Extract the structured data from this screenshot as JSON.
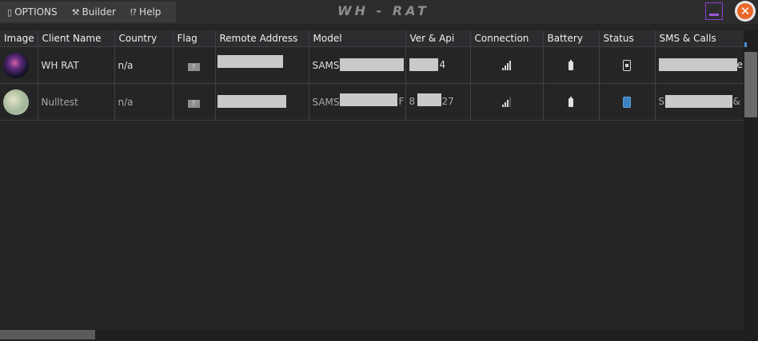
{
  "menu": {
    "items": [
      {
        "icon": "document-icon",
        "glyph": "▯",
        "label": "OPTIONS"
      },
      {
        "icon": "tools-icon",
        "glyph": "⚒",
        "label": "Builder"
      },
      {
        "icon": "help-icon",
        "glyph": "⁉",
        "label": "Help"
      }
    ]
  },
  "app": {
    "title": "WH - RAT"
  },
  "window_controls": {
    "close_glyph": "✕"
  },
  "columns": [
    "Image",
    "Client Name",
    "Country",
    "Flag",
    "Remote Address",
    "Model",
    "Ver & Api",
    "Connection",
    "Battery",
    "Status",
    "SMS & Calls"
  ],
  "rows": [
    {
      "avatar": "avatar-galaxy",
      "client_name": "WH RAT",
      "country": "n/a",
      "flag": "?",
      "model_prefix": "SAMSU",
      "ver_suffix": "4",
      "sms_suffix": "e",
      "signal_bars": 4,
      "status": "phone-locked-icon"
    },
    {
      "avatar": "avatar-floral",
      "client_name": "Nulltest",
      "country": "n/a",
      "flag": "?",
      "model_prefix": "SAMSU",
      "model_suffix": "F",
      "ver_prefix": "8",
      "ver_suffix": "27",
      "sms_prefix": "S",
      "sms_suffix": "&",
      "signal_bars": 3,
      "status": "phone-active-icon"
    }
  ],
  "colors": {
    "accent_minimize": "#8a3fd1",
    "close": "#e8682a",
    "status_active": "#3b82c4"
  }
}
